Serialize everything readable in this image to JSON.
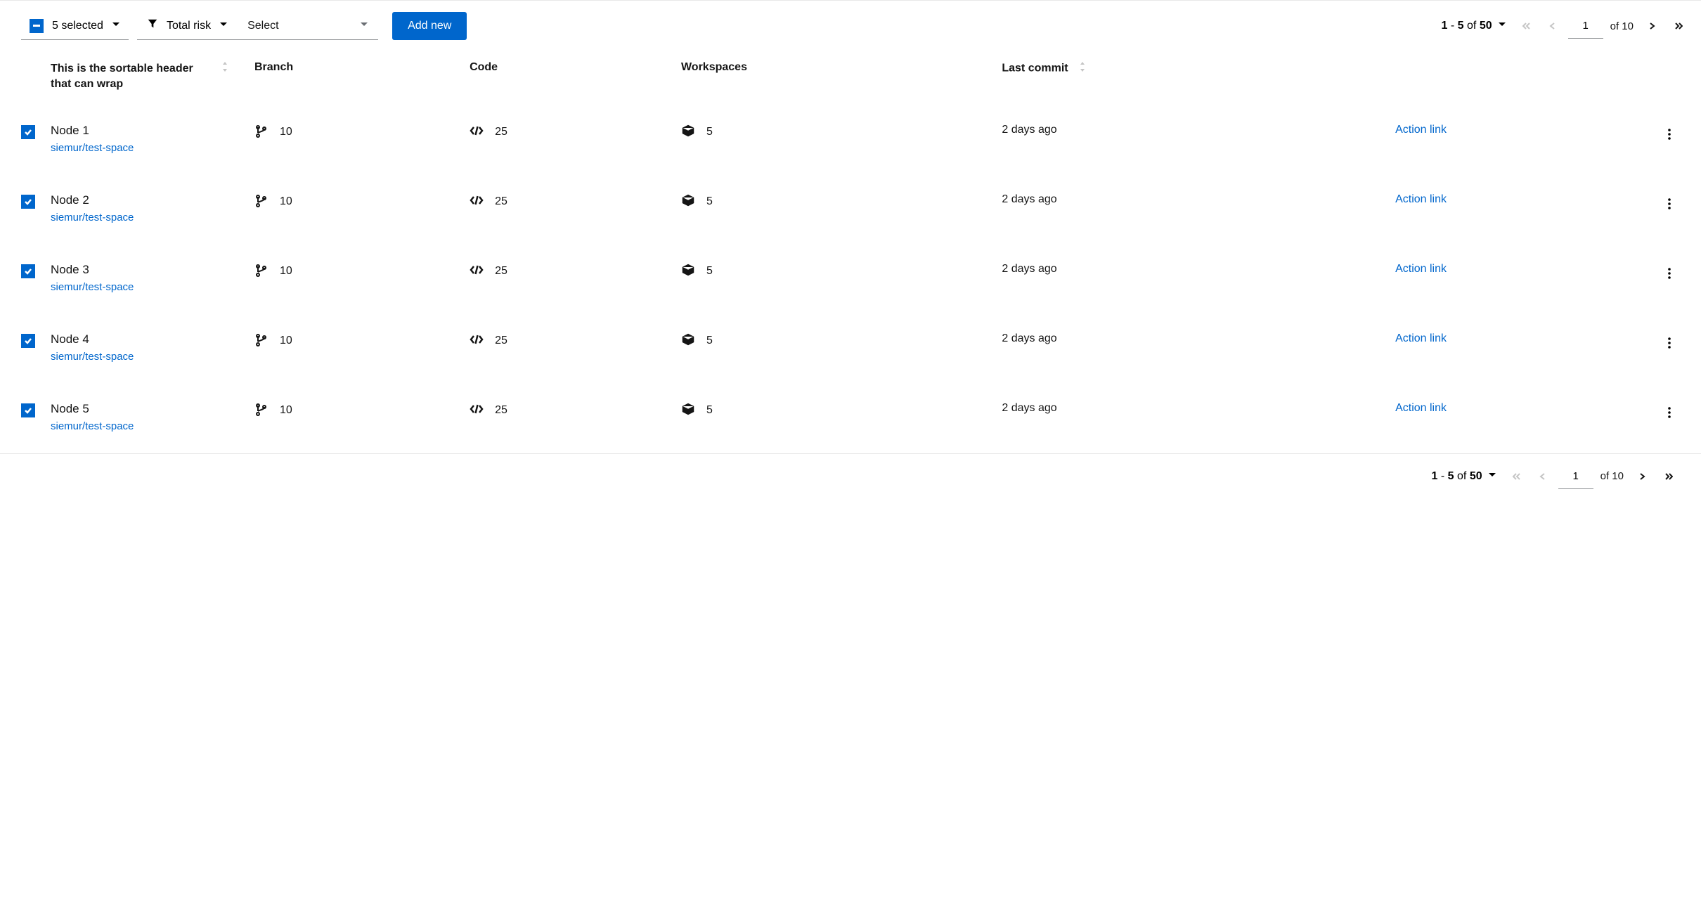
{
  "toolbar": {
    "bulk_label": "5 selected",
    "filter_label": "Total risk",
    "select_placeholder": "Select",
    "add_new_label": "Add new"
  },
  "pagination": {
    "range_start": "1",
    "range_end": "5",
    "total": "50",
    "of_word": "of",
    "page_value": "1",
    "total_pages": "10",
    "of_pages": "of 10"
  },
  "columns": {
    "name": "This is the sortable header that can wrap",
    "branch": "Branch",
    "code": "Code",
    "workspaces": "Workspaces",
    "last_commit": "Last commit"
  },
  "rows": [
    {
      "name": "Node 1",
      "sub": "siemur/test-space",
      "branch": "10",
      "code": "25",
      "workspaces": "5",
      "last_commit": "2 days ago",
      "action": "Action link"
    },
    {
      "name": "Node 2",
      "sub": "siemur/test-space",
      "branch": "10",
      "code": "25",
      "workspaces": "5",
      "last_commit": "2 days ago",
      "action": "Action link"
    },
    {
      "name": "Node 3",
      "sub": "siemur/test-space",
      "branch": "10",
      "code": "25",
      "workspaces": "5",
      "last_commit": "2 days ago",
      "action": "Action link"
    },
    {
      "name": "Node 4",
      "sub": "siemur/test-space",
      "branch": "10",
      "code": "25",
      "workspaces": "5",
      "last_commit": "2 days ago",
      "action": "Action link"
    },
    {
      "name": "Node 5",
      "sub": "siemur/test-space",
      "branch": "10",
      "code": "25",
      "workspaces": "5",
      "last_commit": "2 days ago",
      "action": "Action link"
    }
  ]
}
